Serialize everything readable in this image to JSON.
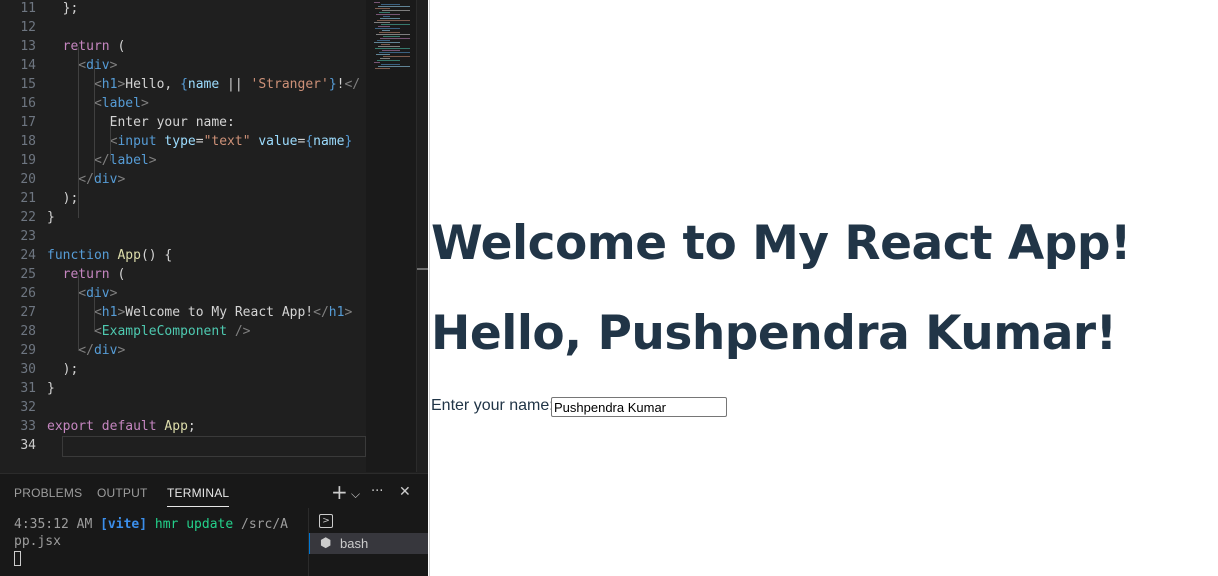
{
  "editor": {
    "lines": [
      {
        "n": "11",
        "tokens": [
          [
            "pn",
            "  };"
          ]
        ]
      },
      {
        "n": "12",
        "tokens": []
      },
      {
        "n": "13",
        "tokens": [
          [
            "kw",
            "  return"
          ],
          [
            "pn",
            " ("
          ]
        ]
      },
      {
        "n": "14",
        "tokens": [
          [
            "br",
            "    <"
          ],
          [
            "tg",
            "div"
          ],
          [
            "br",
            ">"
          ]
        ]
      },
      {
        "n": "15",
        "tokens": [
          [
            "br",
            "      <"
          ],
          [
            "tg",
            "h1"
          ],
          [
            "br",
            ">"
          ],
          [
            "tx",
            "Hello, "
          ],
          [
            "bk",
            "{"
          ],
          [
            "at",
            "name"
          ],
          [
            "pn",
            " || "
          ],
          [
            "st",
            "'Stranger'"
          ],
          [
            "bk",
            "}"
          ],
          [
            "tx",
            "!"
          ],
          [
            "br",
            "</"
          ]
        ]
      },
      {
        "n": "16",
        "tokens": [
          [
            "br",
            "      <"
          ],
          [
            "tg",
            "label"
          ],
          [
            "br",
            ">"
          ]
        ]
      },
      {
        "n": "17",
        "tokens": [
          [
            "tx",
            "        Enter your name:"
          ]
        ]
      },
      {
        "n": "18",
        "tokens": [
          [
            "br",
            "        <"
          ],
          [
            "tg",
            "input"
          ],
          [
            "at",
            " type"
          ],
          [
            "pn",
            "="
          ],
          [
            "st",
            "\"text\""
          ],
          [
            "at",
            " value"
          ],
          [
            "pn",
            "="
          ],
          [
            "bk",
            "{"
          ],
          [
            "at",
            "name"
          ],
          [
            "bk",
            "}"
          ]
        ]
      },
      {
        "n": "19",
        "tokens": [
          [
            "br",
            "      </"
          ],
          [
            "tg",
            "label"
          ],
          [
            "br",
            ">"
          ]
        ]
      },
      {
        "n": "20",
        "tokens": [
          [
            "br",
            "    </"
          ],
          [
            "tg",
            "div"
          ],
          [
            "br",
            ">"
          ]
        ]
      },
      {
        "n": "21",
        "tokens": [
          [
            "pn",
            "  );"
          ]
        ]
      },
      {
        "n": "22",
        "tokens": [
          [
            "pn",
            "}"
          ]
        ]
      },
      {
        "n": "23",
        "tokens": []
      },
      {
        "n": "24",
        "tokens": [
          [
            "bk",
            "function"
          ],
          [
            "fn",
            " App"
          ],
          [
            "pn",
            "() {"
          ]
        ]
      },
      {
        "n": "25",
        "tokens": [
          [
            "kw",
            "  return"
          ],
          [
            "pn",
            " ("
          ]
        ]
      },
      {
        "n": "26",
        "tokens": [
          [
            "br",
            "    <"
          ],
          [
            "tg",
            "div"
          ],
          [
            "br",
            ">"
          ]
        ]
      },
      {
        "n": "27",
        "tokens": [
          [
            "br",
            "      <"
          ],
          [
            "tg",
            "h1"
          ],
          [
            "br",
            ">"
          ],
          [
            "tx",
            "Welcome to My React App!"
          ],
          [
            "br",
            "</"
          ],
          [
            "tg",
            "h1"
          ],
          [
            "br",
            ">"
          ]
        ]
      },
      {
        "n": "28",
        "tokens": [
          [
            "br",
            "      <"
          ],
          [
            "cp",
            "ExampleComponent"
          ],
          [
            "br",
            " />"
          ]
        ]
      },
      {
        "n": "29",
        "tokens": [
          [
            "br",
            "    </"
          ],
          [
            "tg",
            "div"
          ],
          [
            "br",
            ">"
          ]
        ]
      },
      {
        "n": "30",
        "tokens": [
          [
            "pn",
            "  );"
          ]
        ]
      },
      {
        "n": "31",
        "tokens": [
          [
            "pn",
            "}"
          ]
        ]
      },
      {
        "n": "32",
        "tokens": []
      },
      {
        "n": "33",
        "tokens": [
          [
            "kw",
            "export"
          ],
          [
            "kw",
            " default"
          ],
          [
            "fn",
            " App"
          ],
          [
            "pn",
            ";"
          ]
        ]
      },
      {
        "n": "34",
        "tokens": [],
        "active": true
      }
    ]
  },
  "panel": {
    "tabs": [
      "PROBLEMS",
      "OUTPUT",
      "TERMINAL"
    ],
    "active_tab": "TERMINAL",
    "icons": {
      "add": "+",
      "dropdown": "⌵",
      "more": "···",
      "close": "✕"
    },
    "terminal": {
      "time": "4:35:12 AM",
      "tag": "[vite]",
      "message": "hmr update",
      "path_part1": "/src/A",
      "path_part2": "pp.jsx"
    },
    "terminal_list": {
      "launch_icon": ">",
      "bash_label": "bash"
    }
  },
  "preview": {
    "heading_welcome": "Welcome to My React App!",
    "heading_hello": "Hello, Pushpendra Kumar!",
    "label": "Enter your name:",
    "input_value": "Pushpendra Kumar"
  },
  "colors": {
    "editor_bg": "#1f1f1f",
    "heading_color": "#213547",
    "keyword": "#c586c0",
    "tag": "#569cd6",
    "attribute": "#9cdcfe",
    "string": "#ce9178",
    "component": "#4ec9b0",
    "function": "#dcdcaa"
  }
}
